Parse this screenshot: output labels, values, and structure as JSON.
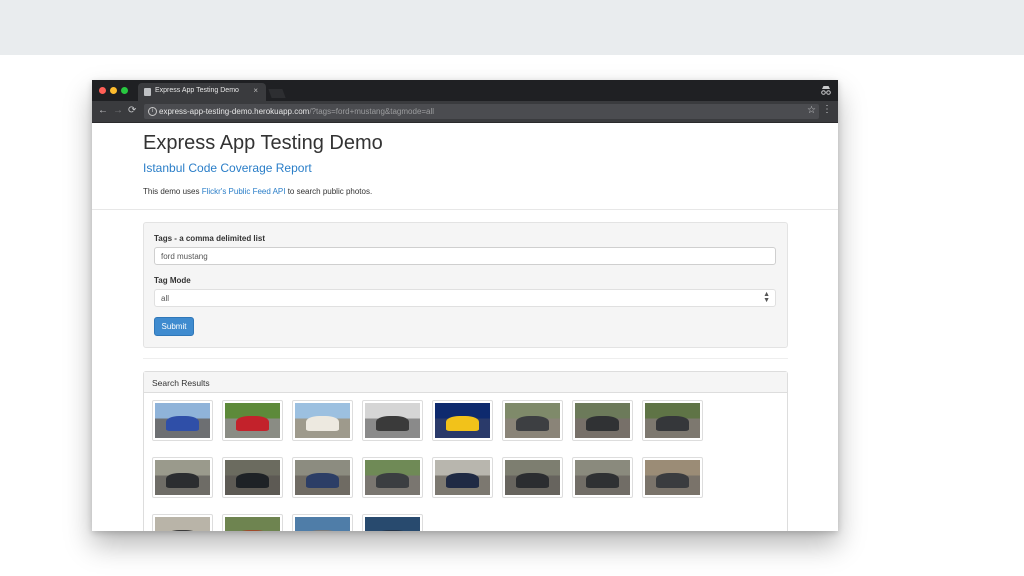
{
  "browser": {
    "tab_title": "Express App Testing Demo",
    "tab_close": "×",
    "url_host": "express-app-testing-demo.herokuapp.com",
    "url_path": "/?tags=ford+mustang&tagmode=all",
    "icons": {
      "back": "arrow-left",
      "forward": "arrow-right",
      "reload": "reload",
      "info": "info",
      "star": "star",
      "menu": "kebab-menu",
      "incognito": "incognito"
    }
  },
  "page": {
    "title": "Express App Testing Demo",
    "subtitle": "Istanbul Code Coverage Report",
    "intro_before": "This demo uses ",
    "intro_link": "Flickr's Public Feed API",
    "intro_after": " to search public photos."
  },
  "form": {
    "tags_label": "Tags - a comma delimited list",
    "tags_value": "ford mustang",
    "tagmode_label": "Tag Mode",
    "tagmode_value": "all",
    "submit_label": "Submit"
  },
  "results": {
    "heading": "Search Results",
    "photos": [
      {
        "sky": "#8fb3d9",
        "ground": "#6d6f72",
        "car": "#2f4fa8"
      },
      {
        "sky": "#5d8a3a",
        "ground": "#8a8c84",
        "car": "#c3222b"
      },
      {
        "sky": "#9cc0e0",
        "ground": "#9e9a8c",
        "car": "#ede9e0"
      },
      {
        "sky": "#d5d5d5",
        "ground": "#8a8a8a",
        "car": "#3a3a3a"
      },
      {
        "sky": "#0e2a6e",
        "ground": "#2a3a6a",
        "car": "#f2c21a"
      },
      {
        "sky": "#7f8a6a",
        "ground": "#8a8478",
        "car": "#3d3f42"
      },
      {
        "sky": "#6c7a5a",
        "ground": "#777069",
        "car": "#303234"
      },
      {
        "sky": "#5f7446",
        "ground": "#7d786f",
        "car": "#35373a"
      },
      {
        "sky": "#9a9a8c",
        "ground": "#6e6c66",
        "car": "#2b2d30"
      },
      {
        "sky": "#6b6b5f",
        "ground": "#5d5a54",
        "car": "#1e2226"
      },
      {
        "sky": "#8c8c80",
        "ground": "#6f6b63",
        "car": "#2c3e66"
      },
      {
        "sky": "#6f8a56",
        "ground": "#7a7670",
        "car": "#3b3e41"
      },
      {
        "sky": "#b8b6ae",
        "ground": "#7c7870",
        "car": "#1f2a44"
      },
      {
        "sky": "#7d7e70",
        "ground": "#67645e",
        "car": "#2b2d30"
      },
      {
        "sky": "#8a8a7d",
        "ground": "#716d66",
        "car": "#2f3133"
      },
      {
        "sky": "#9b8c76",
        "ground": "#7a736a",
        "car": "#3a3c3f"
      },
      {
        "sky": "#b9b4a8",
        "ground": "#8c857a",
        "car": "#3b3b3b"
      },
      {
        "sky": "#6e8450",
        "ground": "#878277",
        "car": "#a04a2a"
      },
      {
        "sky": "#4f7da8",
        "ground": "#5f7a3a",
        "car": "#7a7a7a"
      },
      {
        "sky": "#284a6e",
        "ground": "#3c5a72",
        "car": "#22344a"
      }
    ]
  }
}
